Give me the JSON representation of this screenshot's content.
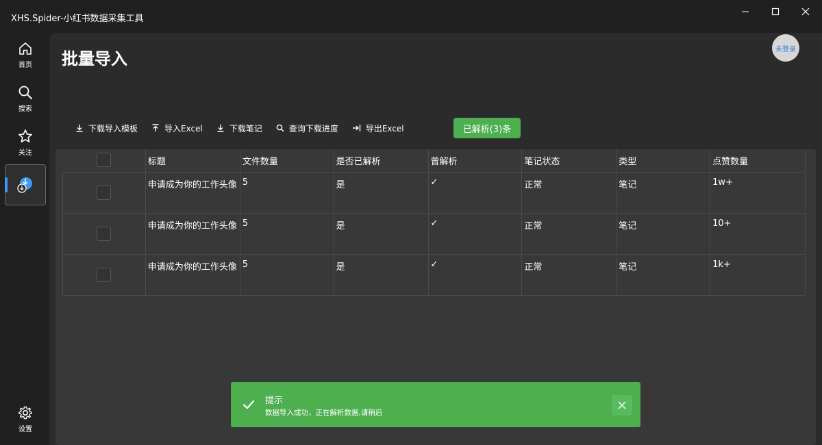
{
  "window": {
    "title": "XHS.Spider-小红书数据采集工具"
  },
  "sidebar": {
    "items": [
      {
        "label": "首页",
        "icon": "home-icon"
      },
      {
        "label": "搜索",
        "icon": "search-icon"
      },
      {
        "label": "关注",
        "icon": "star-icon"
      },
      {
        "label": "",
        "icon": "import-icon",
        "active": true
      },
      {
        "label": "设置",
        "icon": "gear-icon"
      }
    ],
    "accent": "#3b9af5"
  },
  "page": {
    "title": "批量导入",
    "avatar_text": "未登录"
  },
  "toolbar": {
    "download_template": "下载导入模板",
    "import_excel": "导入Excel",
    "download_notes": "下载笔记",
    "query_progress": "查询下载进度",
    "export_excel": "导出Excel",
    "parsed_button": "已解析(3)条"
  },
  "table": {
    "headers": [
      "标题",
      "文件数量",
      "是否已解析",
      "曾解析",
      "笔记状态",
      "类型",
      "点赞数量"
    ],
    "rows": [
      {
        "title": "申请成为你的工作头像",
        "files": "5",
        "parsed": "是",
        "ever_parsed": "✓",
        "status": "正常",
        "type": "笔记",
        "likes": "1w+"
      },
      {
        "title": "申请成为你的工作头像",
        "files": "5",
        "parsed": "是",
        "ever_parsed": "✓",
        "status": "正常",
        "type": "笔记",
        "likes": "10+"
      },
      {
        "title": "申请成为你的工作头像",
        "files": "5",
        "parsed": "是",
        "ever_parsed": "✓",
        "status": "正常",
        "type": "笔记",
        "likes": "1k+"
      }
    ]
  },
  "toast": {
    "title": "提示",
    "message": "数据导入成功，正在解析数据,请稍后",
    "color": "#4caf50"
  }
}
